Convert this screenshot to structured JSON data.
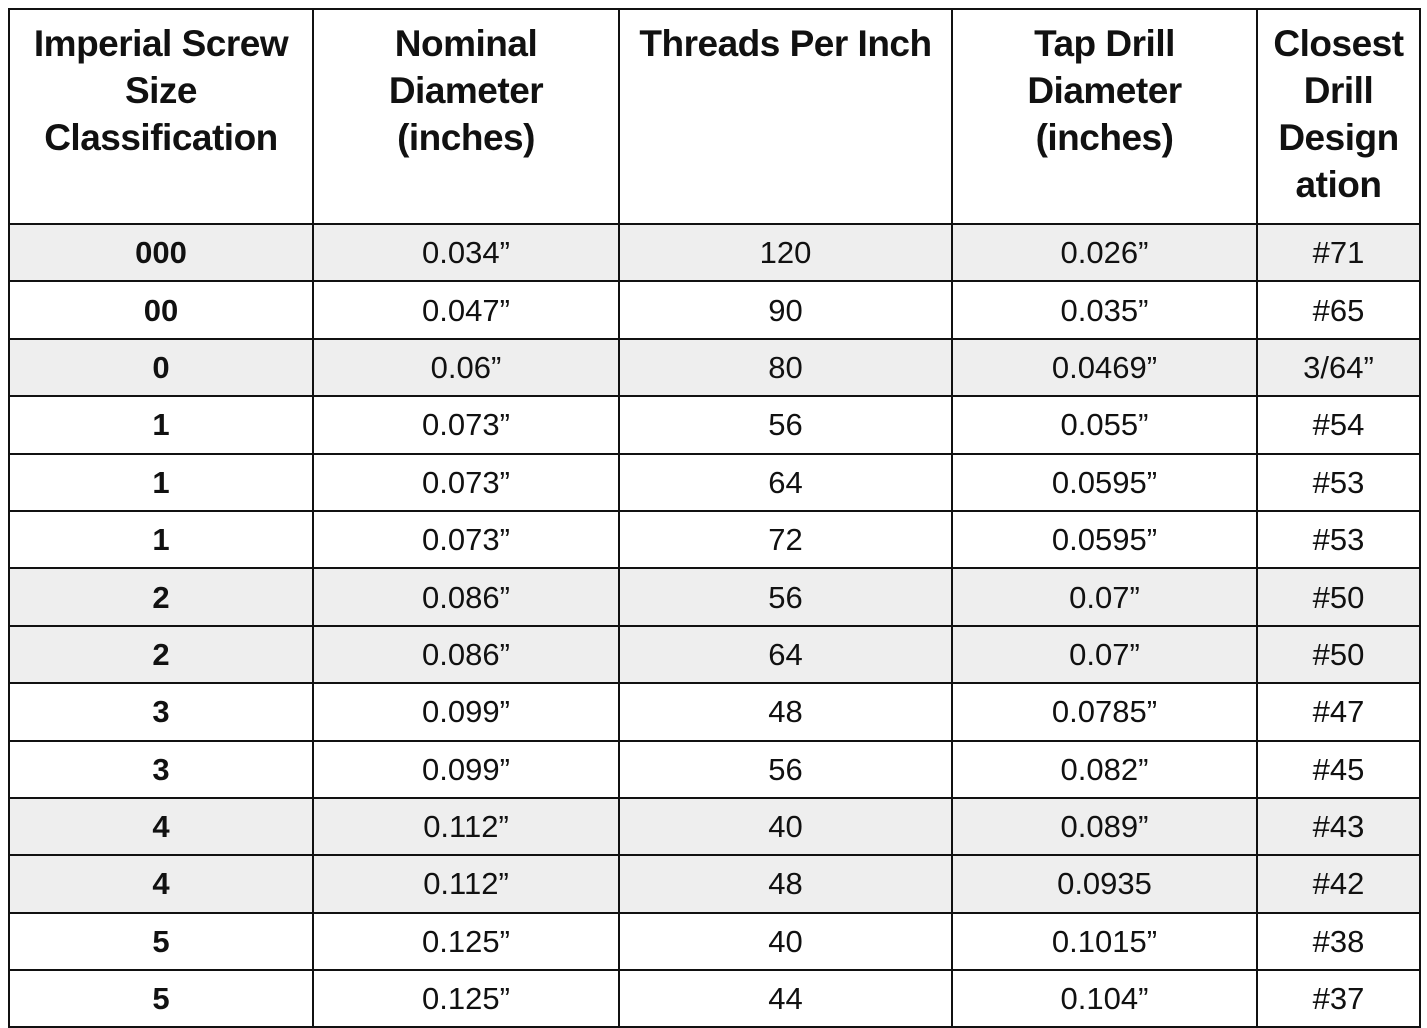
{
  "table": {
    "headers": [
      {
        "lines": [
          "Imperial Screw",
          "Size",
          "Classification"
        ]
      },
      {
        "lines": [
          "Nominal",
          "Diameter",
          "(inches)"
        ]
      },
      {
        "lines": [
          "Threads Per Inch"
        ]
      },
      {
        "lines": [
          "Tap Drill",
          "Diameter",
          "(inches)"
        ]
      },
      {
        "lines": [
          "Closest",
          "Drill",
          "Design",
          "ation"
        ]
      }
    ],
    "shaded_color": "#eeeeee",
    "rows": [
      {
        "size": "000",
        "nominal_diameter": "0.034”",
        "tpi": "120",
        "tap_drill_diameter": "0.026”",
        "closest_drill": "#71",
        "shaded": true
      },
      {
        "size": "00",
        "nominal_diameter": "0.047”",
        "tpi": "90",
        "tap_drill_diameter": "0.035”",
        "closest_drill": "#65",
        "shaded": false
      },
      {
        "size": "0",
        "nominal_diameter": "0.06”",
        "tpi": "80",
        "tap_drill_diameter": "0.0469”",
        "closest_drill": "3/64”",
        "shaded": true
      },
      {
        "size": "1",
        "nominal_diameter": "0.073”",
        "tpi": "56",
        "tap_drill_diameter": "0.055”",
        "closest_drill": "#54",
        "shaded": false
      },
      {
        "size": "1",
        "nominal_diameter": "0.073”",
        "tpi": "64",
        "tap_drill_diameter": "0.0595”",
        "closest_drill": "#53",
        "shaded": false
      },
      {
        "size": "1",
        "nominal_diameter": "0.073”",
        "tpi": "72",
        "tap_drill_diameter": "0.0595”",
        "closest_drill": "#53",
        "shaded": false
      },
      {
        "size": "2",
        "nominal_diameter": "0.086”",
        "tpi": "56",
        "tap_drill_diameter": "0.07”",
        "closest_drill": "#50",
        "shaded": true
      },
      {
        "size": "2",
        "nominal_diameter": "0.086”",
        "tpi": "64",
        "tap_drill_diameter": "0.07”",
        "closest_drill": "#50",
        "shaded": true
      },
      {
        "size": "3",
        "nominal_diameter": "0.099”",
        "tpi": "48",
        "tap_drill_diameter": "0.0785”",
        "closest_drill": "#47",
        "shaded": false
      },
      {
        "size": "3",
        "nominal_diameter": "0.099”",
        "tpi": "56",
        "tap_drill_diameter": "0.082”",
        "closest_drill": "#45",
        "shaded": false
      },
      {
        "size": "4",
        "nominal_diameter": "0.112”",
        "tpi": "40",
        "tap_drill_diameter": "0.089”",
        "closest_drill": "#43",
        "shaded": true
      },
      {
        "size": "4",
        "nominal_diameter": "0.112”",
        "tpi": "48",
        "tap_drill_diameter": "0.0935",
        "closest_drill": "#42",
        "shaded": true
      },
      {
        "size": "5",
        "nominal_diameter": "0.125”",
        "tpi": "40",
        "tap_drill_diameter": "0.1015”",
        "closest_drill": "#38",
        "shaded": false
      },
      {
        "size": "5",
        "nominal_diameter": "0.125”",
        "tpi": "44",
        "tap_drill_diameter": "0.104”",
        "closest_drill": "#37",
        "shaded": false
      }
    ]
  }
}
